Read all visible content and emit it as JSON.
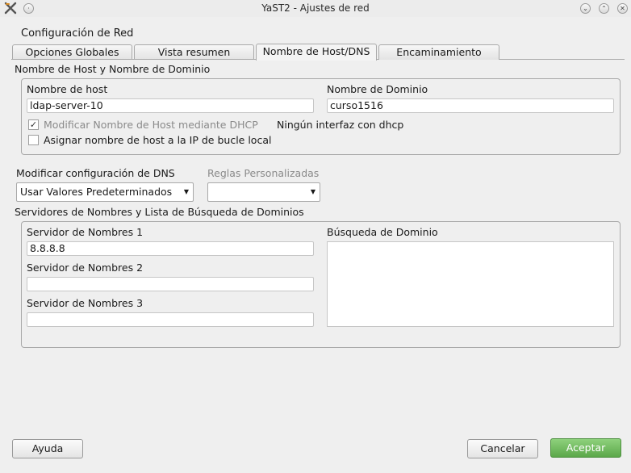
{
  "window": {
    "title": "YaST2 - Ajustes de red",
    "app_icon": "yast-x-icon",
    "controls": [
      "minimize-icon",
      "maximize-icon",
      "close-icon"
    ]
  },
  "heading": "Configuración de Red",
  "tabs": [
    {
      "label": "Opciones Globales",
      "active": false
    },
    {
      "label": "Vista resumen",
      "active": false
    },
    {
      "label": "Nombre de Host/DNS",
      "active": true
    },
    {
      "label": "Encaminamiento",
      "active": false
    }
  ],
  "host_group": {
    "title": "Nombre de Host y Nombre de Dominio",
    "hostname_label": "Nombre de host",
    "hostname_value": "ldap-server-10",
    "domain_label": "Nombre de Dominio",
    "domain_value": "curso1516",
    "dhcp_checkbox_label": "Modificar Nombre de Host mediante DHCP",
    "dhcp_checkbox_checked": true,
    "dhcp_checkbox_enabled": false,
    "dhcp_status": "Ningún interfaz con dhcp",
    "loopback_checkbox_label": "Asignar nombre de host a la IP de bucle local",
    "loopback_checkbox_checked": false
  },
  "dns": {
    "modify_label": "Modificar configuración de DNS",
    "modify_value": "Usar Valores Predeterminados",
    "rules_label": "Reglas Personalizadas",
    "rules_value": ""
  },
  "servers_group": {
    "title": "Servidores de Nombres y Lista de Búsqueda de Dominios",
    "ns1_label": "Servidor de Nombres 1",
    "ns1_value": "8.8.8.8",
    "ns2_label": "Servidor de Nombres 2",
    "ns2_value": "",
    "ns3_label": "Servidor de Nombres 3",
    "ns3_value": "",
    "search_label": "Búsqueda de Dominio",
    "search_value": ""
  },
  "buttons": {
    "help": "Ayuda",
    "cancel": "Cancelar",
    "accept": "Aceptar"
  },
  "colors": {
    "accept_button": "#5ba84a",
    "background": "#efefef"
  }
}
